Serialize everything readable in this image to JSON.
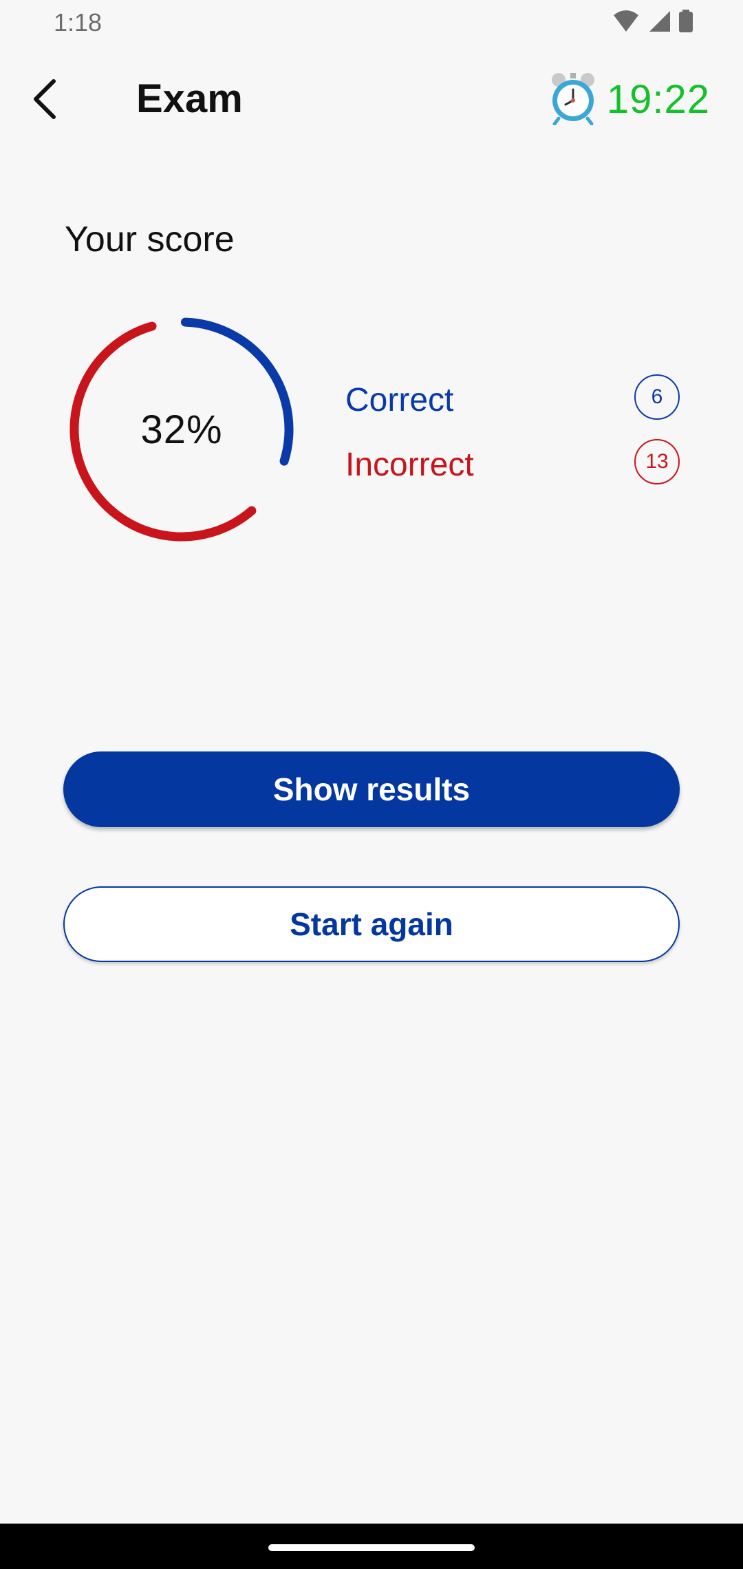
{
  "status_bar": {
    "time": "1:18",
    "icons": [
      "wifi-icon",
      "signal-icon",
      "battery-icon"
    ]
  },
  "header": {
    "back_icon": "chevron-left-icon",
    "title": "Exam",
    "timer_icon": "alarm-clock-icon",
    "timer_value": "19:22"
  },
  "score": {
    "heading": "Your score",
    "percent_label": "32%",
    "correct_fraction": 0.32,
    "legend": [
      {
        "label": "Correct",
        "count": "6",
        "color": "#0a3aa8"
      },
      {
        "label": "Incorrect",
        "count": "13",
        "color": "#c8141b"
      }
    ]
  },
  "actions": {
    "show_results": "Show results",
    "start_again": "Start again"
  },
  "colors": {
    "primary": "#04379f",
    "correct": "#0a3aa8",
    "incorrect": "#c8141b",
    "timer": "#16c02b"
  }
}
